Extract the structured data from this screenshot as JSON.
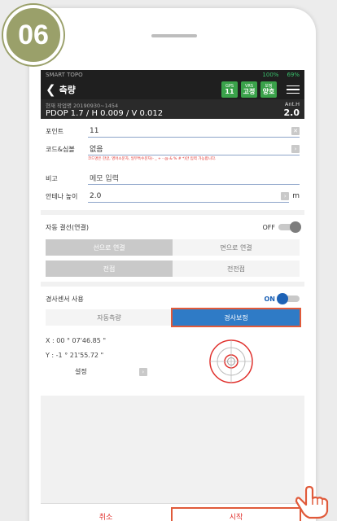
{
  "step_badge": "06",
  "status": {
    "app": "SMART TOPO",
    "signal": "100%",
    "battery": "69%"
  },
  "nav": {
    "back_glyph": "❮",
    "title": "측량",
    "badges": [
      {
        "top": "GPS",
        "val": "11"
      },
      {
        "top": "VRS",
        "val": "고정"
      },
      {
        "top": "보정",
        "val": "양호"
      }
    ]
  },
  "info": {
    "time_label": "현재 작업명 20190930~1454",
    "pdop": "PDOP 1.7 / H 0.009 / V 0.012",
    "ant_label": "Ant.H",
    "ant_value": "2.0"
  },
  "form": {
    "point": {
      "label": "포인트",
      "value": "11"
    },
    "code": {
      "label": "코드&심볼",
      "value": "없음",
      "warning": "코드명은 한글, 영어소문자, 일부특수문자(- _ + - @ & % # *)만 입력 가능합니다."
    },
    "remark": {
      "label": "비고",
      "placeholder": "메모 입력"
    },
    "antenna": {
      "label": "안테나 높이",
      "value": "2.0",
      "unit": "m"
    }
  },
  "autoline": {
    "label": "자동 결선(연결)",
    "state": "OFF",
    "options": [
      "선으로 연결",
      "면으로 연결"
    ],
    "options2": [
      "전점",
      "전전점"
    ]
  },
  "tilt": {
    "label": "경사센서 사용",
    "state": "ON",
    "tabs": [
      "자동측량",
      "경사보정"
    ],
    "x": "X : 00 ° 07'46.85 \"",
    "y": "Y : -1 ° 21'55.72 \"",
    "setting": "설정"
  },
  "footer": {
    "cancel": "취소",
    "start": "시작"
  }
}
